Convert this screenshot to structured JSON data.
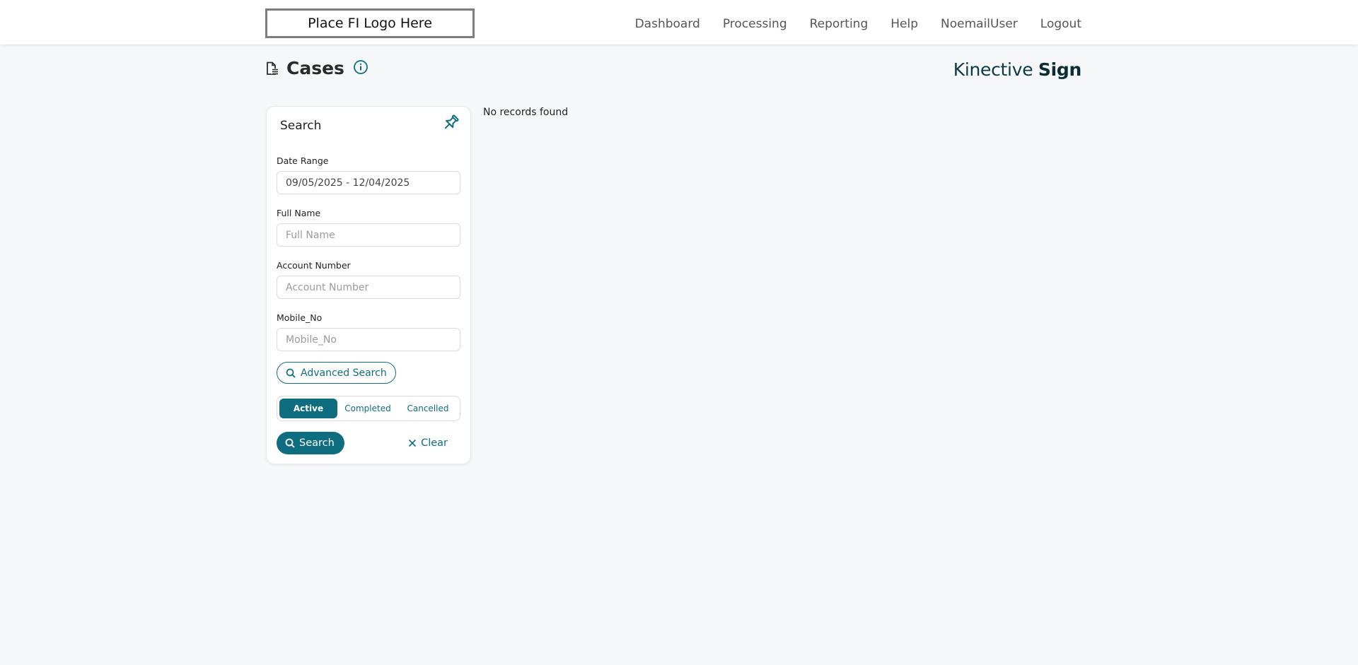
{
  "header": {
    "logo_text": "Place FI Logo Here",
    "nav": [
      "Dashboard",
      "Processing",
      "Reporting",
      "Help",
      "NoemailUser",
      "Logout"
    ]
  },
  "page": {
    "title": "Cases",
    "brand_regular": "Kinective ",
    "brand_bold": "Sign"
  },
  "search_panel": {
    "title": "Search",
    "date_range": {
      "label": "Date Range",
      "value": "09/05/2025 - 12/04/2025"
    },
    "full_name": {
      "label": "Full Name",
      "placeholder": "Full Name",
      "value": ""
    },
    "account_number": {
      "label": "Account Number",
      "placeholder": "Account Number",
      "value": ""
    },
    "mobile_no": {
      "label": "Mobile_No",
      "placeholder": "Mobile_No",
      "value": ""
    },
    "advanced_search_label": "Advanced Search",
    "status_tabs": [
      "Active",
      "Completed",
      "Cancelled"
    ],
    "active_tab": "Active",
    "search_label": "Search",
    "clear_label": "Clear"
  },
  "results": {
    "empty_message": "No records found"
  },
  "colors": {
    "accent": "#0e6e80",
    "background": "#f5f7f9"
  },
  "icons": {
    "page": "document-list-icon",
    "info": "info-icon",
    "pin": "pin-icon",
    "search": "search-icon",
    "clear": "close-icon"
  }
}
